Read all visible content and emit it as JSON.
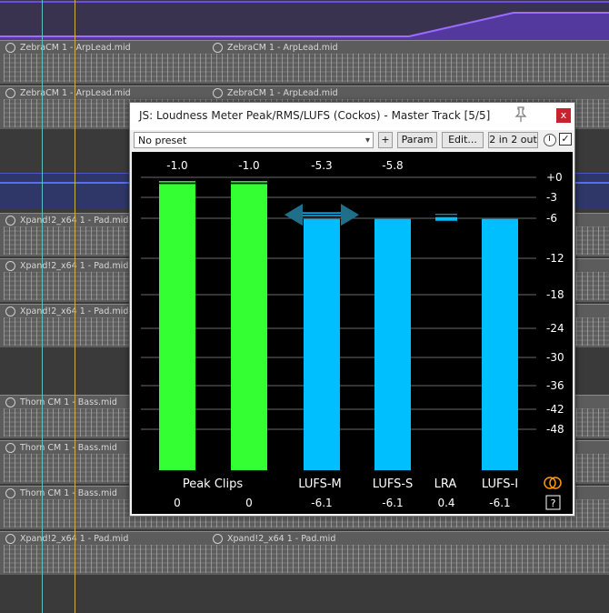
{
  "daw": {
    "tracks": [
      {
        "label_a": "ZebraCM 1 - ArpLead.mid",
        "label_b": "ZebraCM 1 - ArpLead.mid"
      },
      {
        "label_a": "ZebraCM 1 - ArpLead.mid",
        "label_b": "ZebraCM 1 - ArpLead.mid"
      },
      {
        "label_a": "Xpand!2_x64 1 - Pad.mid",
        "label_b": ""
      },
      {
        "label_a": "Xpand!2_x64 1 - Pad.mid",
        "label_b": ""
      },
      {
        "label_a": "Xpand!2_x64 1 - Pad.mid",
        "label_b": ""
      },
      {
        "label_a": "Thorn CM 1 - Bass.mid",
        "label_b": ""
      },
      {
        "label_a": "Thorn CM 1 - Bass.mid",
        "label_b": ""
      },
      {
        "label_a": "Thorn CM 1 - Bass.mid",
        "label_b": ""
      },
      {
        "label_a": "Xpand!2_x64 1 - Pad.mid",
        "label_b": "Xpand!2_x64 1 - Pad.mid"
      }
    ]
  },
  "plugin": {
    "title": "JS: Loudness Meter Peak/RMS/LUFS (Cockos) - Master Track [5/5]",
    "close_label": "x",
    "preset_value": "No preset",
    "plus_label": "+",
    "param_label": "Param",
    "edit_label": "Edit...",
    "io_label": "2 in 2 out",
    "checkbox_checked": "✓",
    "help_label": "?"
  },
  "meter": {
    "colors": {
      "peak": "#33ff33",
      "lufs": "#00bfff",
      "grid": "#6a6a6a",
      "text": "#ffffff",
      "handle": "#1f6f8b",
      "loop_icon": "#ff9900"
    },
    "scale_labels": [
      "+0",
      "-3",
      "-6",
      "-12",
      "-18",
      "-24",
      "-30",
      "-36",
      "-42",
      "-48"
    ],
    "scale_values": [
      0,
      -3,
      -6,
      -12,
      -18,
      -24,
      -30,
      -36,
      -42,
      -48
    ],
    "bars": [
      {
        "top_label": "-1.0",
        "level_db": -1.0,
        "color": "peak"
      },
      {
        "top_label": "-1.0",
        "level_db": -1.0,
        "color": "peak"
      },
      {
        "top_label": "-5.3",
        "level_db": -6.1,
        "color": "lufs"
      },
      {
        "top_label": "-5.8",
        "level_db": -6.1,
        "color": "lufs"
      },
      {
        "top_label": "",
        "level_db": null,
        "color": "lufs"
      },
      {
        "top_label": "",
        "level_db": -6.1,
        "color": "lufs"
      }
    ],
    "lra_marker_db": -6.1,
    "target_marker_db": -5.5,
    "bottom_labels": [
      "Peak Clips",
      "LUFS-M",
      "LUFS-S",
      "LRA",
      "LUFS-I"
    ],
    "bottom_values": [
      "0",
      "0",
      "-6.1",
      "-6.1",
      "0.4",
      "-6.1"
    ]
  }
}
